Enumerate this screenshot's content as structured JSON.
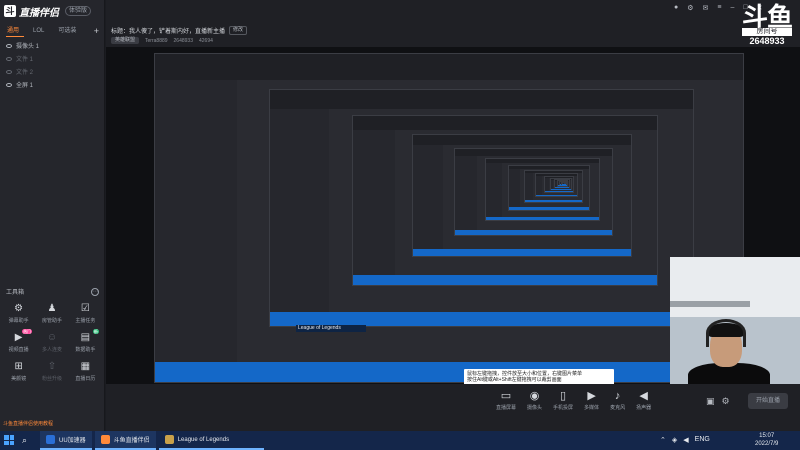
{
  "app": {
    "logo_text": "直播伴侣",
    "version": "体验版"
  },
  "sidebar": {
    "tabs": [
      "通用",
      "LOL",
      "可选装"
    ],
    "plus": "+",
    "scenes": [
      {
        "label": "摄像头 1",
        "dim": false
      },
      {
        "label": "文件 1",
        "dim": true
      },
      {
        "label": "文件 2",
        "dim": true
      },
      {
        "label": "全屏 1",
        "dim": false
      }
    ],
    "toolbox_title": "工具箱",
    "tools": [
      {
        "icon": "gear",
        "label": "弹幕助手",
        "badge": "",
        "disabled": false
      },
      {
        "icon": "user",
        "label": "房管助手",
        "badge": "",
        "disabled": false
      },
      {
        "icon": "clipboard",
        "label": "主播任务",
        "badge": "",
        "disabled": false
      },
      {
        "icon": "video",
        "label": "视频直播",
        "badge": "热门",
        "disabled": false
      },
      {
        "icon": "people",
        "label": "多人连麦",
        "badge": "",
        "disabled": true
      },
      {
        "icon": "chart",
        "label": "数据助手",
        "badge": "新",
        "disabled": false
      },
      {
        "icon": "grid",
        "label": "美颜镜",
        "badge": "",
        "disabled": false
      },
      {
        "icon": "up",
        "label": "粉丝升级",
        "badge": "",
        "disabled": true
      },
      {
        "icon": "calendar",
        "label": "直播日历",
        "badge": "",
        "disabled": false
      }
    ],
    "status_text": "斗鱼直播伴侣使用教程"
  },
  "header": {
    "room_title": "标题：我人傻了，铲着斯内好，直播新主播",
    "edit_label": "修改",
    "category": "英雄联盟",
    "streamer": "Terra8889",
    "room_id": "2648933",
    "viewers": "42694",
    "douyu_big": "斗鱼",
    "douyu_box": "房间号",
    "douyu_id": "2648933"
  },
  "preview": {
    "tooltip_lines": [
      "鼠标左键拖拽，控件放至大小和位置，右键图片菜单",
      "按住Alt键或Alt+Shift左键拖拽可以裁剪画面",
      "Ctrl+V粘贴文本/图片",
      "右键图片菜单，支持\"截图\"功能"
    ],
    "lol_task": "League of Legends"
  },
  "controls": {
    "items": [
      {
        "icon": "screen",
        "label": "直播屏幕"
      },
      {
        "icon": "camera",
        "label": "摄像头"
      },
      {
        "icon": "phone",
        "label": "手机投屏"
      },
      {
        "icon": "play",
        "label": "多媒体"
      },
      {
        "icon": "mic",
        "label": "麦克风"
      },
      {
        "icon": "speaker",
        "label": "扬声器"
      }
    ],
    "start_label": "开始直播"
  },
  "taskbar": {
    "apps": [
      {
        "label": "UU加速器",
        "color": "#2a6fd6"
      },
      {
        "label": "斗鱼直播伴侣",
        "color": "#ff8a3a"
      },
      {
        "label": "League of Legends",
        "color": "#c9a14a"
      }
    ],
    "tray": [
      "ENG"
    ],
    "time": "15:07",
    "date": "2022/7/9"
  }
}
